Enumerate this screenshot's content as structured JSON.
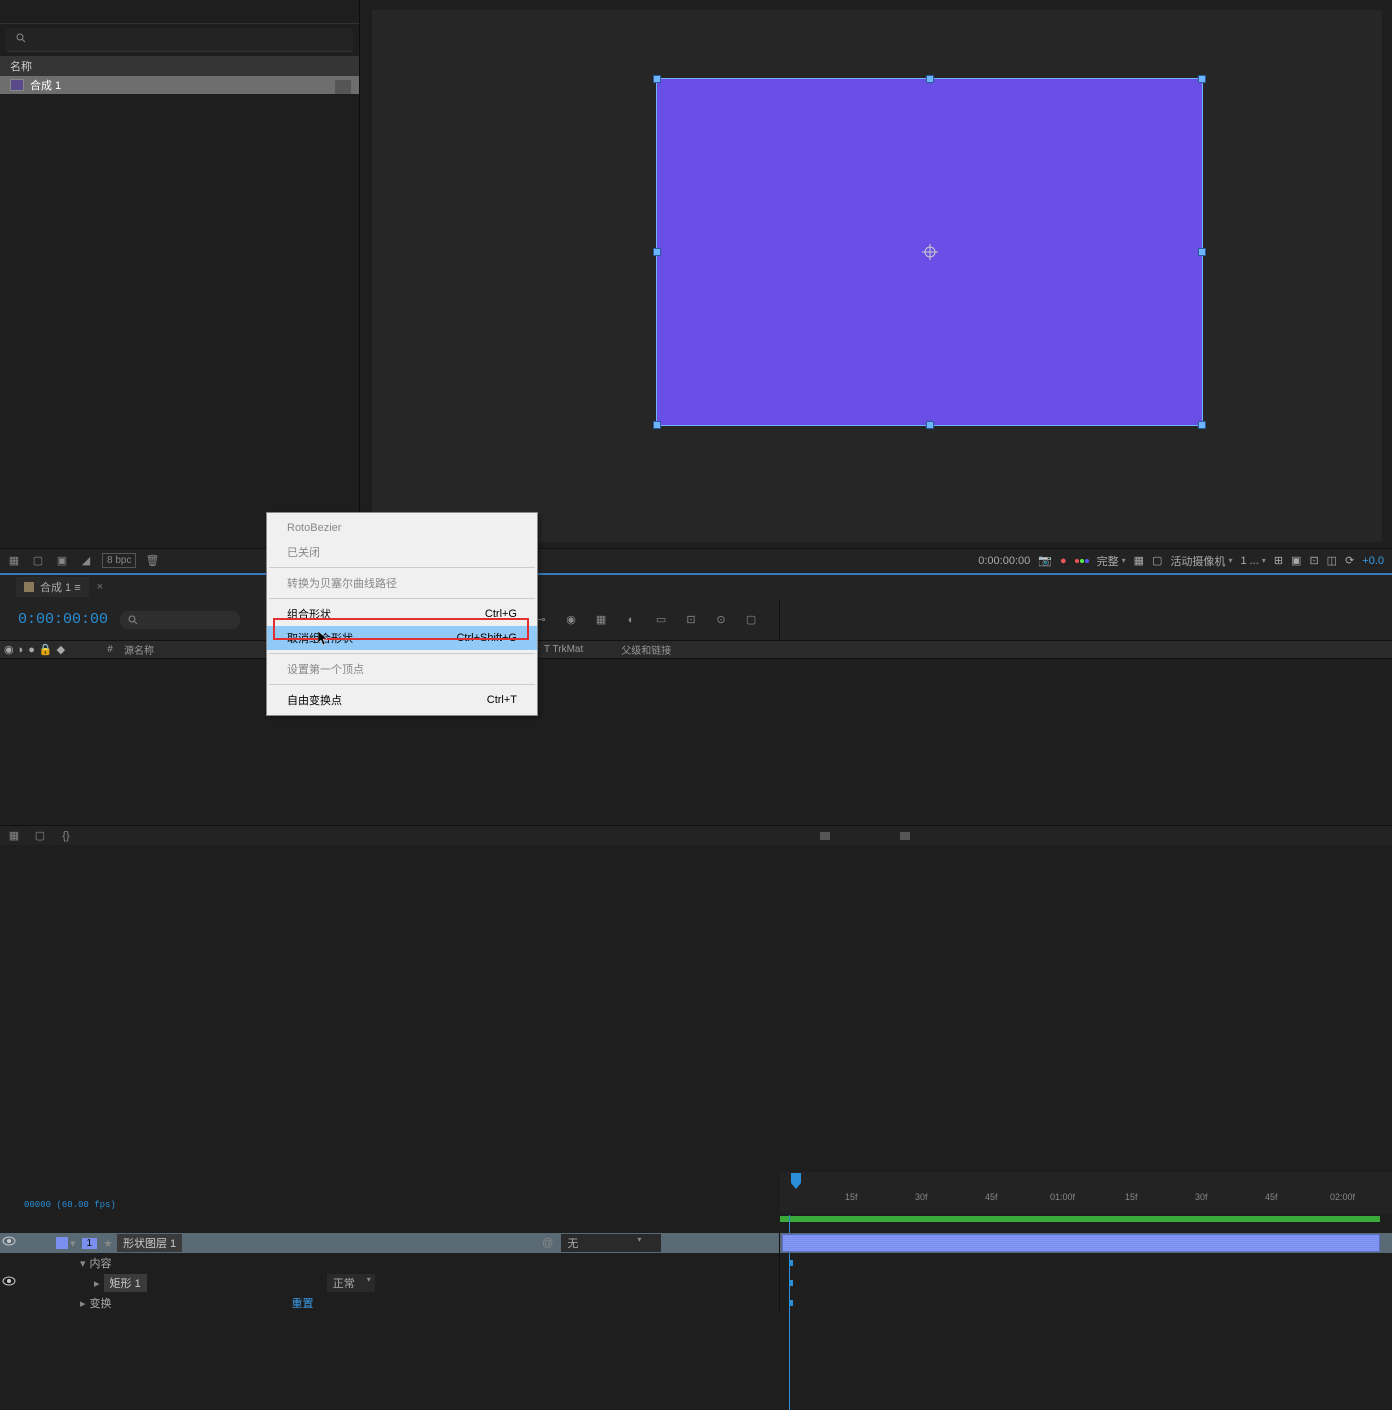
{
  "project": {
    "name_header": "名称",
    "item_name": "合成 1",
    "bpc": "8 bpc"
  },
  "viewer": {
    "timecode": "0:00:00:00",
    "resolution": "完整",
    "camera": "活动摄像机",
    "view_count": "1 ...",
    "exposure": "+0.0"
  },
  "timeline": {
    "tab_name": "合成 1",
    "timecode": "0:00:00:00",
    "timecode_sub": "00000 (60.00 fps)",
    "cols": {
      "hash": "#",
      "source_name": "源名称",
      "trkmat": "T  TrkMat",
      "parent": "父级和链接"
    },
    "layer1": {
      "num": "1",
      "name": "形状图层 1",
      "parent": "无"
    },
    "contents": "内容",
    "rect1": "矩形 1",
    "rect1_mode": "正常",
    "transform": "变换",
    "reset": "重置",
    "ruler_ticks": [
      "15f",
      "30f",
      "45f",
      "01:00f",
      "15f",
      "30f",
      "45f",
      "02:00f"
    ]
  },
  "menu": {
    "rotobezier": "RotoBezier",
    "closed": "已关闭",
    "convert_bezier": "转换为贝塞尔曲线路径",
    "group": "组合形状",
    "group_key": "Ctrl+G",
    "ungroup": "取消组合形状",
    "ungroup_key": "Ctrl+Shift+G",
    "first_vertex": "设置第一个顶点",
    "free_transform": "自由变换点",
    "free_transform_key": "Ctrl+T"
  }
}
